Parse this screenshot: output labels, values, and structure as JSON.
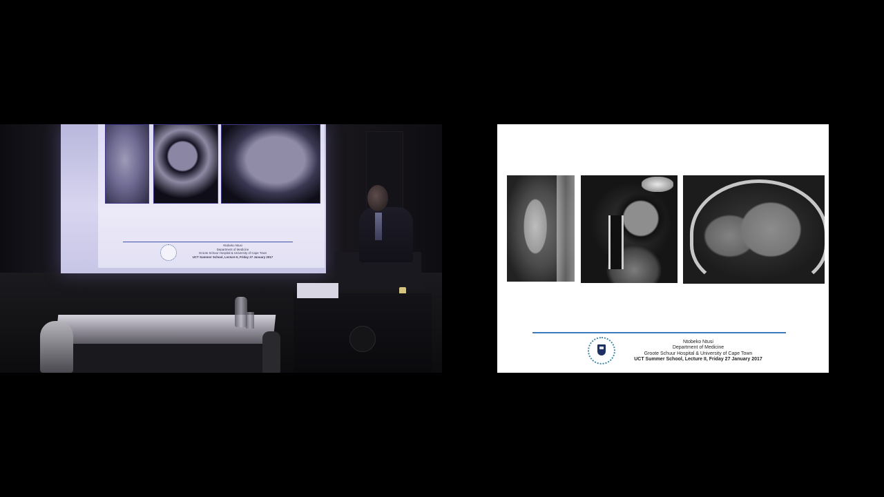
{
  "slide": {
    "presenter_name": "Ntobeko Ntusi",
    "department": "Department of Medicine",
    "institution": "Groote Schuur Hospital & University of Cape Town",
    "lecture": "UCT Summer School, Lecture II, Friday 27 January 2017"
  },
  "colors": {
    "rule": "#3a79bd",
    "slide_bg": "#ffffff",
    "background": "#000000"
  },
  "icons": {
    "seal": "uct-seal-icon"
  }
}
